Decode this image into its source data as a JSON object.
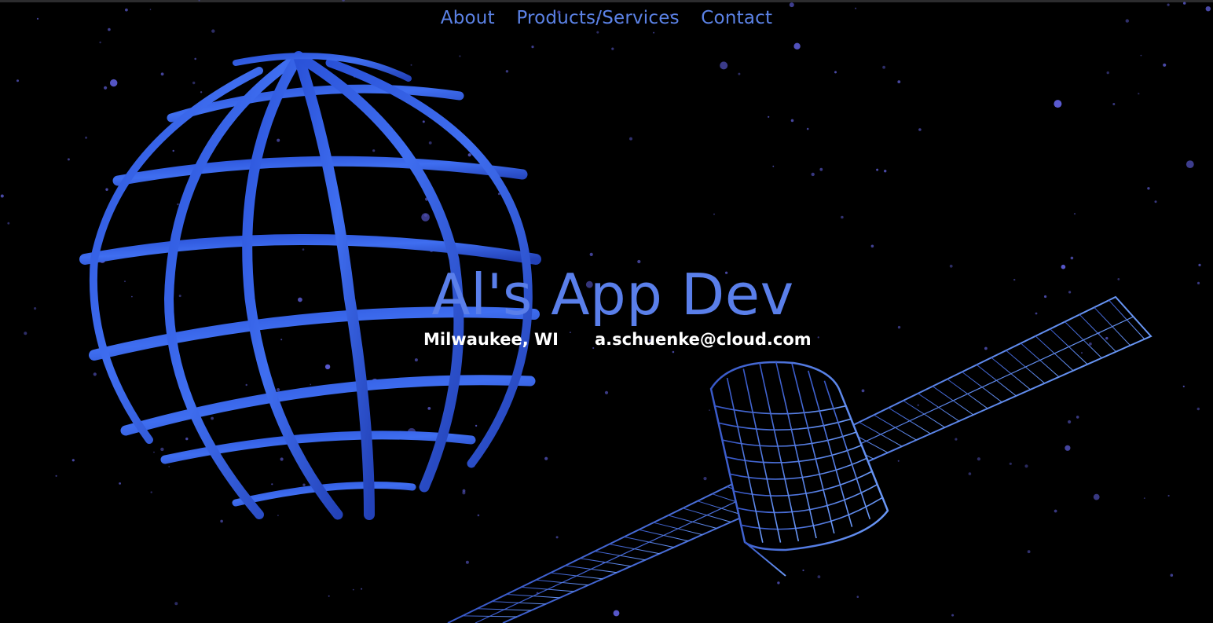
{
  "nav": {
    "items": [
      {
        "label": "About"
      },
      {
        "label": "Products/Services"
      },
      {
        "label": "Contact"
      }
    ]
  },
  "hero": {
    "title": "Al's App Dev",
    "location": "Milwaukee, WI",
    "email": "a.schuenke@cloud.com"
  },
  "colors": {
    "background": "#000000",
    "accent": "#5a7fea",
    "globe": "#3f6ef0",
    "satellite": "#5b8df2",
    "stars": "#6b6bd6",
    "subtitle": "#ffffff"
  },
  "icons": {
    "globe": "wireframe-globe-graphic",
    "satellite": "wireframe-satellite-graphic"
  }
}
